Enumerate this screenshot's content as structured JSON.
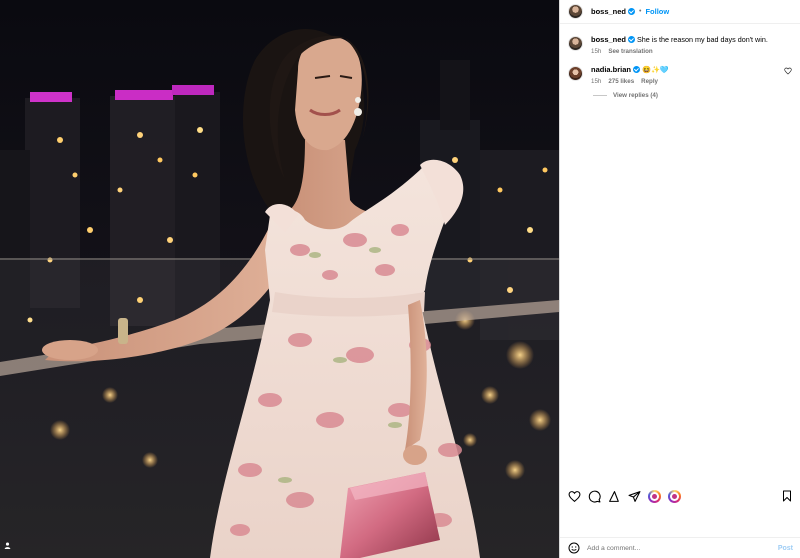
{
  "post": {
    "author": "boss_ned",
    "follow_label": "Follow",
    "separator": "•"
  },
  "comments": [
    {
      "username": "boss_ned",
      "text": "She is the reason my bad days don't win.",
      "time": "15h",
      "action": "See translation"
    },
    {
      "username": "nadia.brian",
      "text": "😆✨🩵",
      "time": "15h",
      "likes": "275 likes",
      "action": "Reply",
      "view_replies": "View replies (4)"
    }
  ],
  "actions": {
    "icons": [
      "heart-icon",
      "comment-icon",
      "share-icon",
      "send-icon",
      "story-ring-icon",
      "story-ring-icon",
      "bookmark-icon"
    ]
  },
  "composer": {
    "placeholder": "Add a comment...",
    "post_label": "Post"
  },
  "colors": {
    "accent": "#0095f6",
    "muted": "#737373",
    "night": "#0c0d14",
    "dress": "#f1e2db",
    "bag": "#d9778c"
  }
}
